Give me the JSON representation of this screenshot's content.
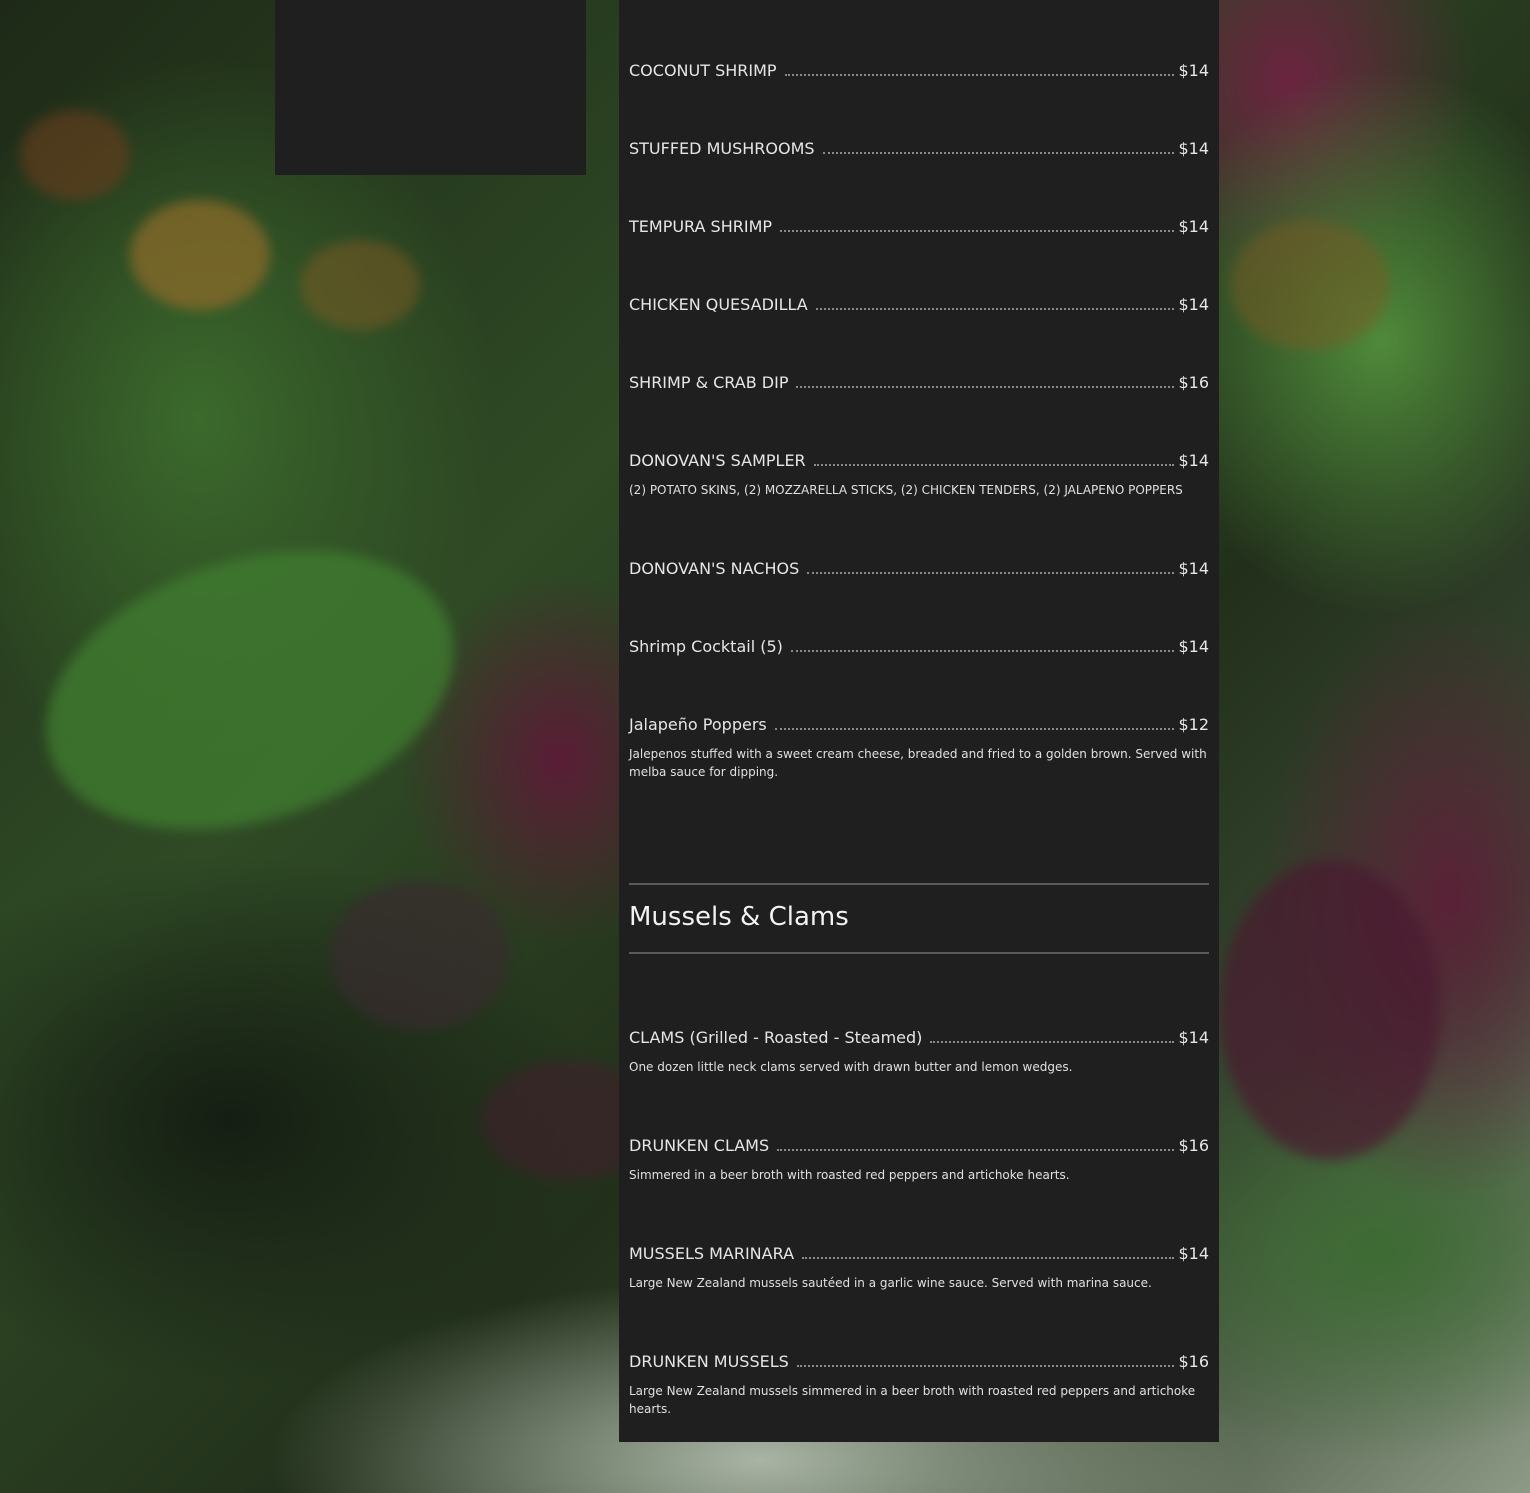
{
  "appetizers": [
    {
      "name": "COCONUT SHRIMP",
      "price": "$14",
      "description": ""
    },
    {
      "name": "STUFFED MUSHROOMS",
      "price": "$14",
      "description": ""
    },
    {
      "name": "TEMPURA SHRIMP",
      "price": "$14",
      "description": ""
    },
    {
      "name": "CHICKEN QUESADILLA",
      "price": "$14",
      "description": ""
    },
    {
      "name": "SHRIMP & CRAB DIP",
      "price": "$16",
      "description": ""
    },
    {
      "name": "DONOVAN'S SAMPLER",
      "price": "$14",
      "description": "(2) POTATO SKINS, (2) MOZZARELLA STICKS, (2) CHICKEN TENDERS, (2) JALAPENO POPPERS"
    },
    {
      "name": "DONOVAN'S NACHOS",
      "price": "$14",
      "description": ""
    },
    {
      "name": "Shrimp Cocktail (5)",
      "price": "$14",
      "description": ""
    },
    {
      "name": "Jalapeño Poppers",
      "price": "$12",
      "description": "Jalepenos stuffed with a sweet cream cheese, breaded and fried to a golden brown. Served with melba sauce for dipping."
    }
  ],
  "mussels_section": {
    "title": "Mussels & Clams",
    "items": [
      {
        "name": "CLAMS (Grilled - Roasted - Steamed)",
        "price": "$14",
        "description": "One dozen little neck clams served with drawn butter and lemon wedges."
      },
      {
        "name": "DRUNKEN CLAMS",
        "price": "$16",
        "description": "Simmered in a beer broth with roasted red peppers and artichoke hearts."
      },
      {
        "name": "MUSSELS MARINARA",
        "price": "$14",
        "description": "Large New Zealand mussels sautéed in a garlic wine sauce. Served with marina sauce."
      },
      {
        "name": "DRUNKEN MUSSELS",
        "price": "$16",
        "description": "Large New Zealand mussels simmered in a beer broth with roasted red peppers and artichoke hearts."
      }
    ]
  },
  "colors": {
    "panel_background": "#1f1f1f",
    "text": "#e6e6e6",
    "rule": "#5a5a5a"
  }
}
